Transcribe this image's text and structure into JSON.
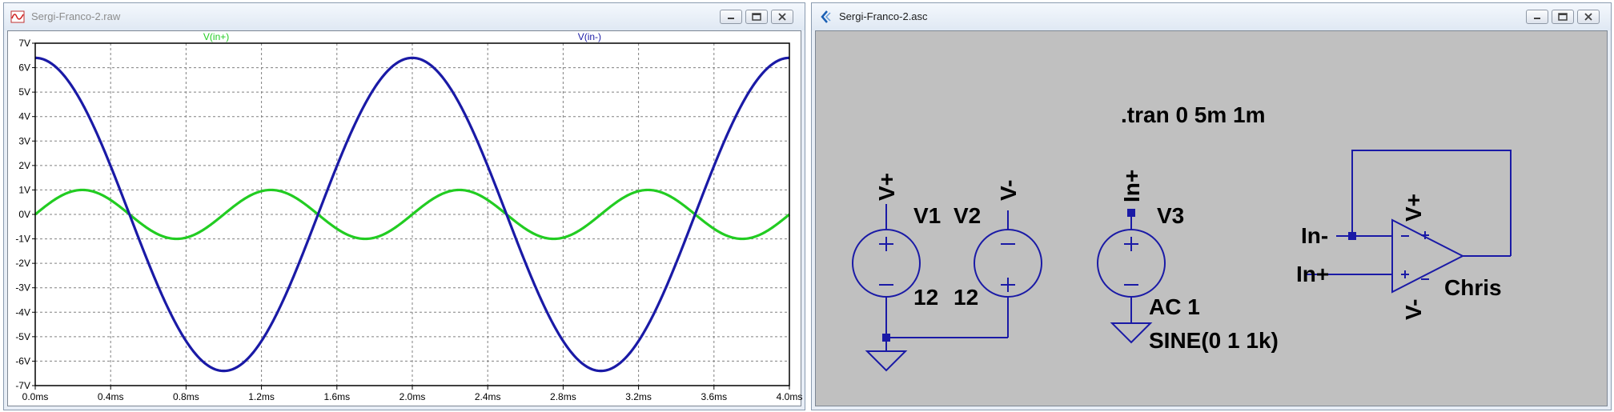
{
  "waveform_window": {
    "title": "Sergi-Franco-2.raw",
    "trace_labels": [
      {
        "label": "V(in+)",
        "color": "#22cc22"
      },
      {
        "label": "V(in-)",
        "color": "#1a1aa6"
      }
    ]
  },
  "schematic_window": {
    "title": "Sergi-Franco-2.asc",
    "directive": ".tran 0 5m 1m",
    "v1": {
      "name": "V1",
      "value": "12",
      "net": "V+"
    },
    "v2": {
      "name": "V2",
      "value": "12",
      "net": "V-"
    },
    "v3": {
      "name": "V3",
      "net": "In+",
      "ac": "AC 1",
      "sine": "SINE(0 1 1k)"
    },
    "opamp": {
      "name": "Chris",
      "inv_label": "In-",
      "noninv_label": "In+",
      "vpos_label": "V+",
      "vneg_label": "V-"
    },
    "colors": {
      "wire": "#1a1aa6",
      "background": "#c0c0c0"
    }
  },
  "chart_data": {
    "type": "line",
    "x": {
      "unit": "ms",
      "range": [
        0,
        4
      ],
      "ticks": [
        "0.0ms",
        "0.4ms",
        "0.8ms",
        "1.2ms",
        "1.6ms",
        "2.0ms",
        "2.4ms",
        "2.8ms",
        "3.2ms",
        "3.6ms",
        "4.0ms"
      ]
    },
    "y": {
      "unit": "V",
      "range": [
        -7,
        7
      ],
      "ticks": [
        "7V",
        "6V",
        "5V",
        "4V",
        "3V",
        "2V",
        "1V",
        "0V",
        "-1V",
        "-2V",
        "-3V",
        "-4V",
        "-5V",
        "-6V",
        "-7V"
      ]
    },
    "grid": true,
    "series": [
      {
        "name": "V(in+)",
        "color": "#22cc22",
        "amplitude": 1.0,
        "frequency_khz": 1,
        "phase": "sine",
        "description_values": {
          "peak": 1.0,
          "trough": -1.0,
          "period_ms": 1.0
        }
      },
      {
        "name": "V(in-)",
        "color": "#1a1aa6",
        "amplitude": 6.4,
        "frequency_khz": 0.5,
        "phase": "cosine",
        "description_values": {
          "peak": 6.4,
          "trough": -6.4,
          "period_ms": 2.0
        }
      }
    ]
  }
}
